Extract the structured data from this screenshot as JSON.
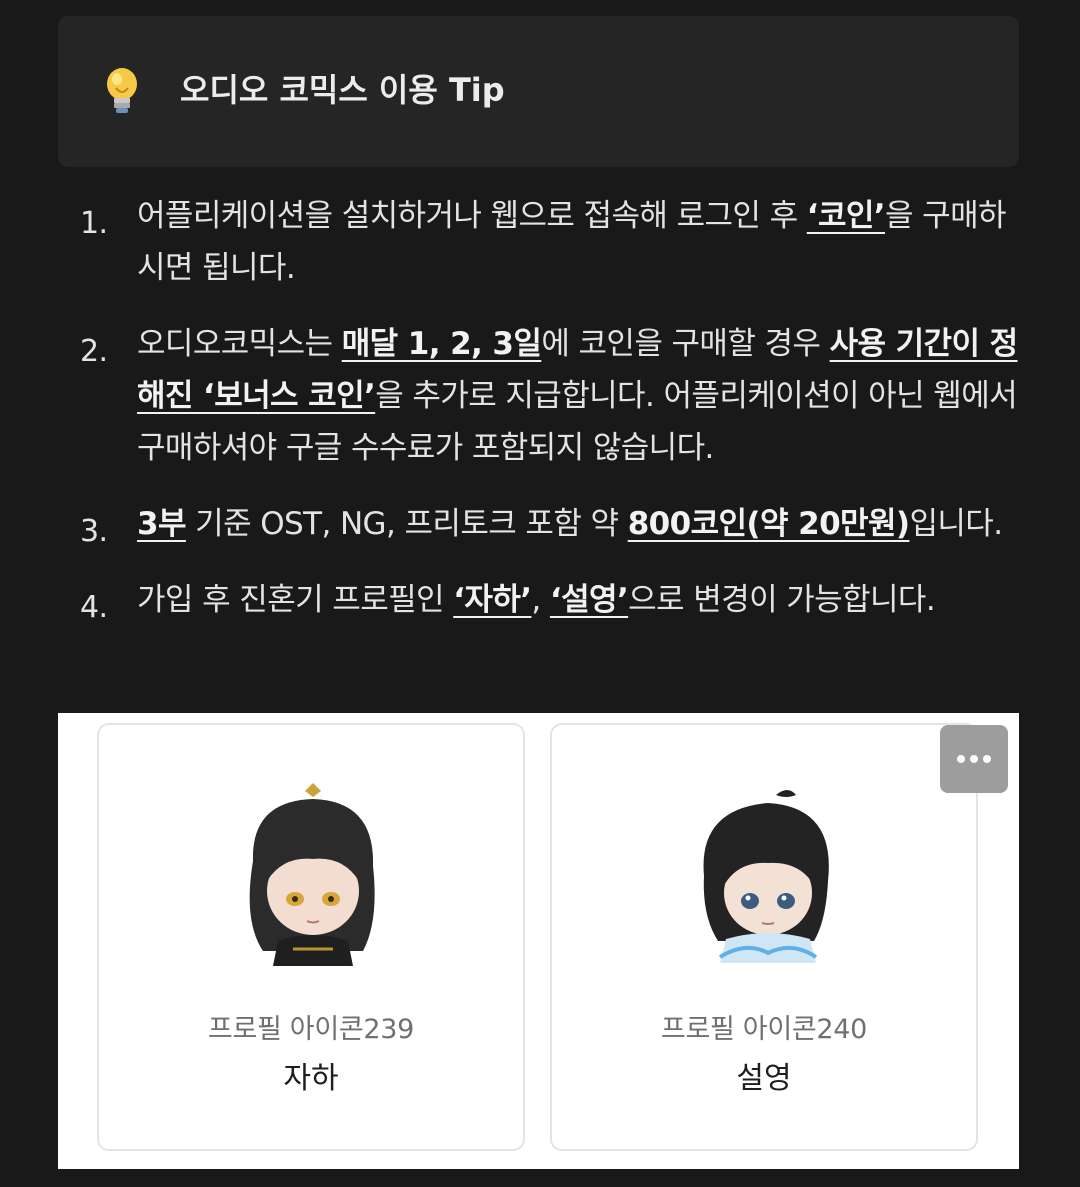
{
  "callout": {
    "title": "오디오 코믹스 이용 Tip",
    "icon": "lightbulb-icon"
  },
  "tips": [
    {
      "number": "1.",
      "segments": [
        {
          "text": "어플리케이션을 설치하거나 웹으로 접속해 로그인 후 ",
          "bold": false
        },
        {
          "text": "‘코인’",
          "bold": true
        },
        {
          "text": "을 구매하시면 됩니다.",
          "bold": false
        }
      ]
    },
    {
      "number": "2.",
      "segments": [
        {
          "text": "오디오코믹스는 ",
          "bold": false
        },
        {
          "text": "매달 1, 2, 3일",
          "bold": true
        },
        {
          "text": "에 코인을 구매할 경우 ",
          "bold": false
        },
        {
          "text": "사용 기간이 정해진 ‘보너스 코인’",
          "bold": true
        },
        {
          "text": "을 추가로 지급합니다. 어플리케이션이 아닌 웹에서 구매하셔야 구글 수수료가 포함되지 않습니다.",
          "bold": false
        }
      ]
    },
    {
      "number": "3.",
      "segments": [
        {
          "text": "3부",
          "bold": true
        },
        {
          "text": " 기준 OST, NG, 프리토크 포함 약 ",
          "bold": false
        },
        {
          "text": "800코인(약 20만원)",
          "bold": true
        },
        {
          "text": "입니다.",
          "bold": false
        }
      ]
    },
    {
      "number": "4.",
      "segments": [
        {
          "text": "가입 후 진혼기 프로필인 ",
          "bold": false
        },
        {
          "text": "‘자하’",
          "bold": true
        },
        {
          "text": ", ",
          "bold": false
        },
        {
          "text": "‘설영’",
          "bold": true
        },
        {
          "text": "으로 변경이 가능합니다.",
          "bold": false
        }
      ]
    }
  ],
  "profiles": [
    {
      "icon_label": "프로필 아이콘239",
      "name": "자하"
    },
    {
      "icon_label": "프로필 아이콘240",
      "name": "설영"
    }
  ],
  "more_icon": "more-horizontal-icon"
}
